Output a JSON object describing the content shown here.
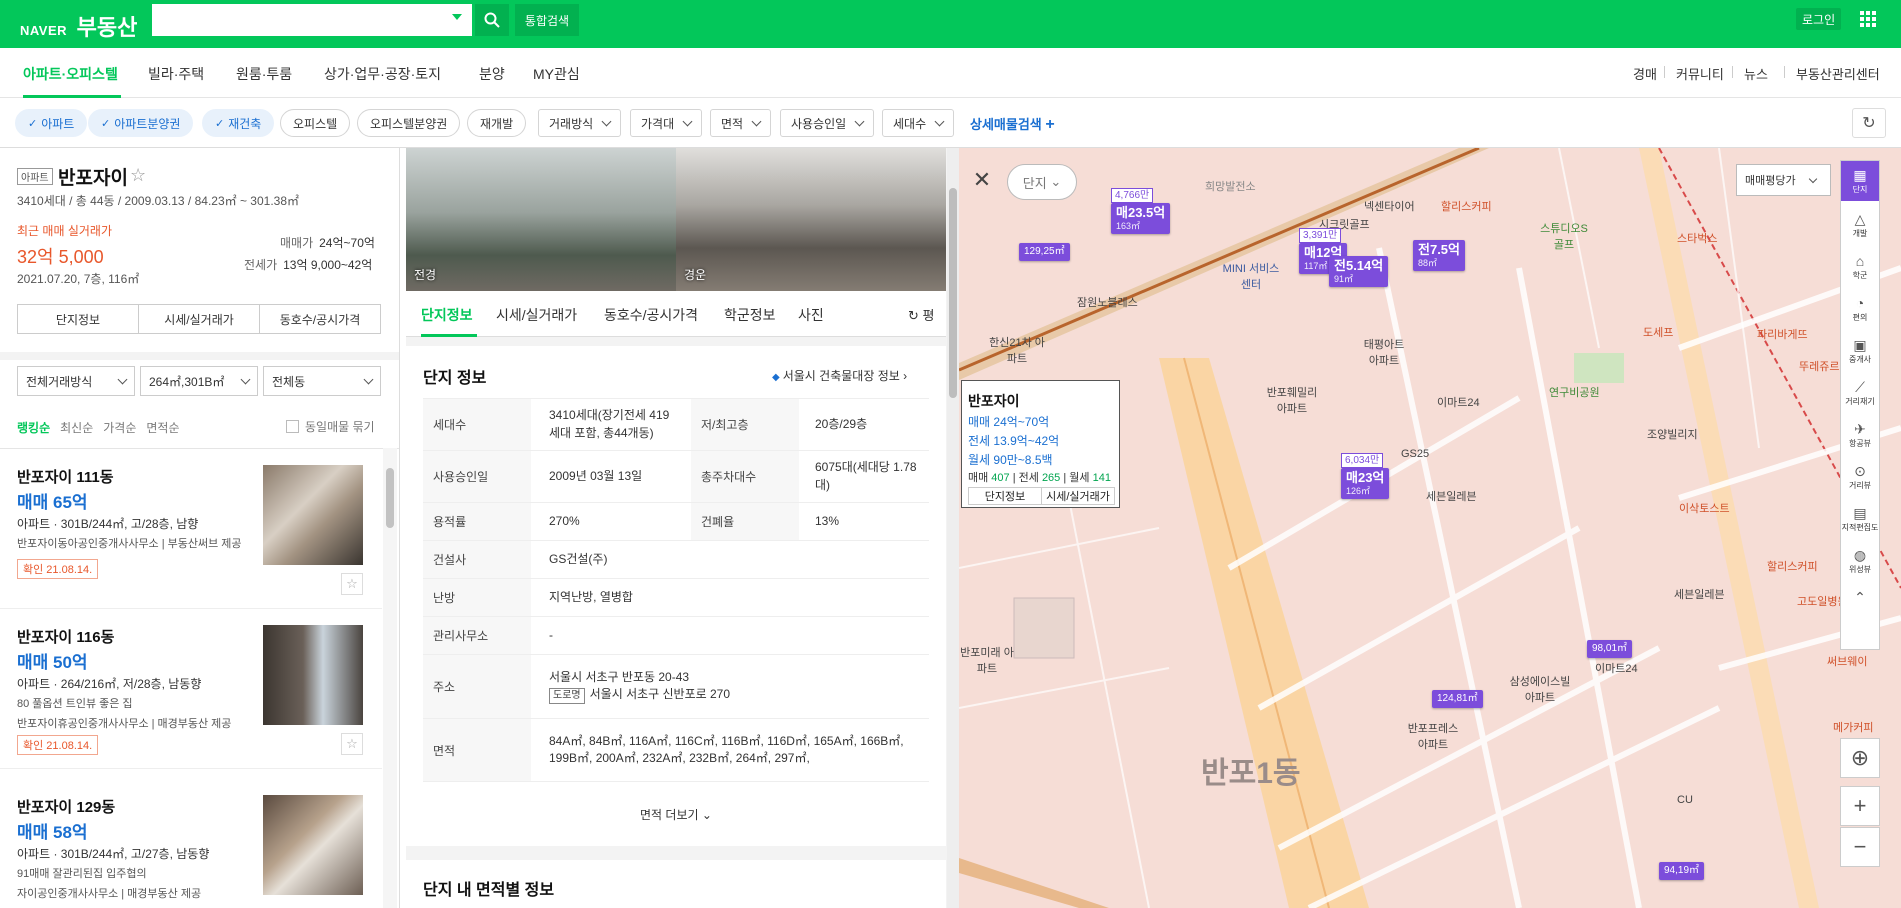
{
  "header": {
    "logo_naver": "NAVER",
    "logo_service": "부동산",
    "search_placeholder": "",
    "combo_search": "통합검색",
    "login": "로그인"
  },
  "nav": {
    "items": [
      "아파트·오피스텔",
      "빌라·주택",
      "원룸·투룸",
      "상가·업무·공장·토지",
      "분양",
      "MY관심"
    ],
    "right": [
      "경매",
      "커뮤니티",
      "뉴스",
      "부동산관리센터"
    ]
  },
  "filters": {
    "chips": [
      "아파트",
      "아파트분양권",
      "재건축",
      "오피스텔",
      "오피스텔분양권",
      "재개발"
    ],
    "dropdowns": [
      "거래방식",
      "가격대",
      "면적",
      "사용승인일",
      "세대수"
    ],
    "detail": "상세매물검색"
  },
  "complex": {
    "type_tag": "아파트",
    "name": "반포자이",
    "meta": "3410세대 / 총 44동 / 2009.03.13 / 84.23㎡ ~ 301.38㎡",
    "recent_label": "최근 매매 실거래가",
    "recent_price": "32억 5,000",
    "recent_info": "2021.07.20, 7층, 116㎡",
    "sale_label": "매매가",
    "sale_range": "24억~70억",
    "jeonse_label": "전세가",
    "jeonse_range": "13억 9,000~42억",
    "tabs": [
      "단지정보",
      "시세/실거래가",
      "동호수/공시가격"
    ]
  },
  "list_filters": {
    "type": "전체거래방식",
    "area": "264㎡,301B㎡",
    "dong": "전체동",
    "sort": [
      "랭킹순",
      "최신순",
      "가격순",
      "면적순"
    ],
    "group": "동일매물 묶기"
  },
  "listings": [
    {
      "title": "반포자이 111동",
      "price": "매매 65억",
      "desc": "아파트 · 301B/244㎡, 고/28층, 남향",
      "agent": "반포자이동아공인중개사사무소 | 부동산써브 제공",
      "extra": "",
      "confirm": "확인 21.08.14."
    },
    {
      "title": "반포자이 116동",
      "price": "매매 50억",
      "desc": "아파트 · 264/216㎡, 저/28층, 남동향",
      "extra": "80 풀옵션 트인뷰 좋은 집",
      "agent": "반포자이휴공인중개사사무소 | 매경부동산 제공",
      "confirm": "확인 21.08.14."
    },
    {
      "title": "반포자이 129동",
      "price": "매매 58억",
      "desc": "아파트 · 301B/244㎡, 고/27층, 남동향",
      "extra": "91매매 잘관리된집 입주협의",
      "agent": "자이공인중개사사무소 | 매경부동산 제공",
      "confirm": ""
    }
  ],
  "photos": [
    "전경",
    "경운"
  ],
  "detail_tabs": [
    "단지정보",
    "시세/실거래가",
    "동호수/공시가격",
    "학군정보",
    "사진"
  ],
  "detail_tab_more": "평",
  "info": {
    "title": "단지 정보",
    "ledger": "서울시 건축물대장 정보",
    "rows": [
      {
        "k": "세대수",
        "v": "3410세대(장기전세 419세대 포함, 총44개동)",
        "k2": "저/최고층",
        "v2": "20층/29층"
      },
      {
        "k": "사용승인일",
        "v": "2009년 03월 13일",
        "k2": "총주차대수",
        "v2": "6075대(세대당 1.78대)"
      },
      {
        "k": "용적률",
        "v": "270%",
        "k2": "건폐율",
        "v2": "13%"
      },
      {
        "k": "건설사",
        "v": "GS건설(주)"
      },
      {
        "k": "난방",
        "v": "지역난방, 열병합"
      },
      {
        "k": "관리사무소",
        "v": "-"
      },
      {
        "k": "주소",
        "v": "서울시 서초구 반포동 20-43",
        "road_tag": "도로명",
        "road": "서울시 서초구 신반포로 270"
      },
      {
        "k": "면적",
        "v": "84A㎡, 84B㎡, 116A㎡, 116C㎡, 116B㎡, 116D㎡, 165A㎡, 166B㎡, 199B㎡, 200A㎡, 232A㎡, 232B㎡, 264㎡, 297㎡,"
      }
    ],
    "more": "면적 더보기",
    "section2": "단지 내 면적별 정보"
  },
  "map": {
    "danji": "단지",
    "price_select": "매매평당가",
    "popup": {
      "name": "반포자이",
      "sale": "매매 24억~70억",
      "jeonse": "전세 13.9억~42억",
      "monthly": "월세 90만~8.5백",
      "cnt_sale": "407",
      "cnt_jeonse": "265",
      "cnt_monthly": "141",
      "btn1": "단지정보",
      "btn2": "시세/실거래가"
    },
    "markers": [
      {
        "top": "4,766만",
        "price": "매23.5억",
        "area": "163㎡"
      },
      {
        "top": "",
        "price": "129,25㎡",
        "area": ""
      },
      {
        "top": "3,391만",
        "price": "매12억",
        "area": "117㎡"
      },
      {
        "top": "",
        "price": "전5.14억",
        "area": "91㎡"
      },
      {
        "top": "",
        "price": "전7.5억",
        "area": "88㎡"
      },
      {
        "top": "6,034만",
        "price": "매23억",
        "area": "126㎡"
      },
      {
        "top": "",
        "price": "98,01㎡",
        "area": ""
      },
      {
        "top": "",
        "price": "124,81㎡",
        "area": ""
      },
      {
        "top": "",
        "price": "94,19㎡",
        "area": ""
      }
    ],
    "district": "반포1동",
    "labels": [
      "희망발전소",
      "시크릿골프",
      "넥센타이어",
      "할리스커피",
      "스튜디오S골프",
      "스타벅스",
      "MINI 서비스센터",
      "잠원노블레스",
      "한신21차 아파트",
      "반포훼밀리 아파트",
      "태평아트 아파트",
      "이마트24",
      "연구비공원",
      "도세프",
      "조양빌리지",
      "GS25",
      "세븐일레븐",
      "이삭토스트",
      "할리스커피",
      "파리바게뜨",
      "삼성에이스빌 아파트",
      "반포프레스 아파트",
      "메가커피",
      "써브웨이",
      "고도일병원",
      "세븐일레븐",
      "이마트24",
      "반포미래 아파트",
      "뚜레쥬르",
      "CU"
    ],
    "tools": [
      "단지",
      "개발",
      "학군",
      "편의",
      "중개사",
      "거리재기",
      "항공뷰",
      "거리뷰",
      "지적편집도",
      "위성뷰"
    ]
  }
}
